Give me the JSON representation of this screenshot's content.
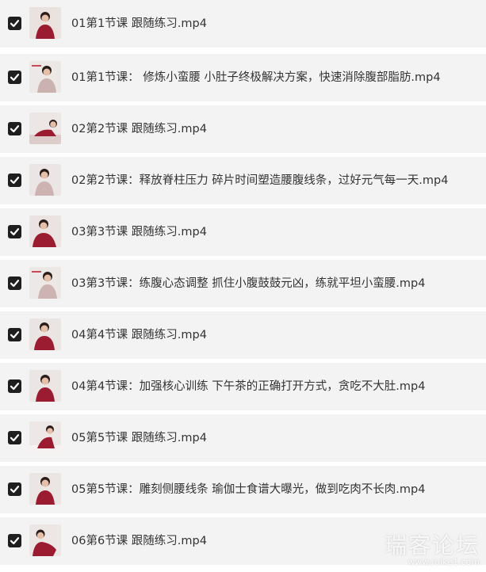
{
  "files": [
    {
      "name": "01第1节课 跟随练习.mp4",
      "checked": true
    },
    {
      "name": "01第1节课： 修炼小蛮腰 小肚子终极解决方案，快速消除腹部脂肪.mp4",
      "checked": true
    },
    {
      "name": "02第2节课 跟随练习.mp4",
      "checked": true
    },
    {
      "name": "02第2节课：释放脊柱压力 碎片时间塑造腰腹线条，过好元气每一天.mp4",
      "checked": true
    },
    {
      "name": "03第3节课 跟随练习.mp4",
      "checked": true
    },
    {
      "name": "03第3节课：练腹心态调整 抓住小腹鼓鼓元凶，练就平坦小蛮腰.mp4",
      "checked": true
    },
    {
      "name": "04第4节课 跟随练习.mp4",
      "checked": true
    },
    {
      "name": "04第4节课：加强核心训练 下午茶的正确打开方式，贪吃不大肚.mp4",
      "checked": true
    },
    {
      "name": "05第5节课 跟随练习.mp4",
      "checked": true
    },
    {
      "name": "05第5节课：雕刻侧腰线条 瑜伽士食谱大曝光，做到吃肉不长肉.mp4",
      "checked": true
    },
    {
      "name": "06第6节课 跟随练习.mp4",
      "checked": true
    }
  ],
  "watermark": {
    "main": "瑞客论坛",
    "sub": "www.ruike1.com"
  },
  "colors": {
    "row_bg": "#f3f3f4",
    "checkbox": "#1f1f1f",
    "text": "#333333",
    "shirt": "#9b1c31"
  }
}
